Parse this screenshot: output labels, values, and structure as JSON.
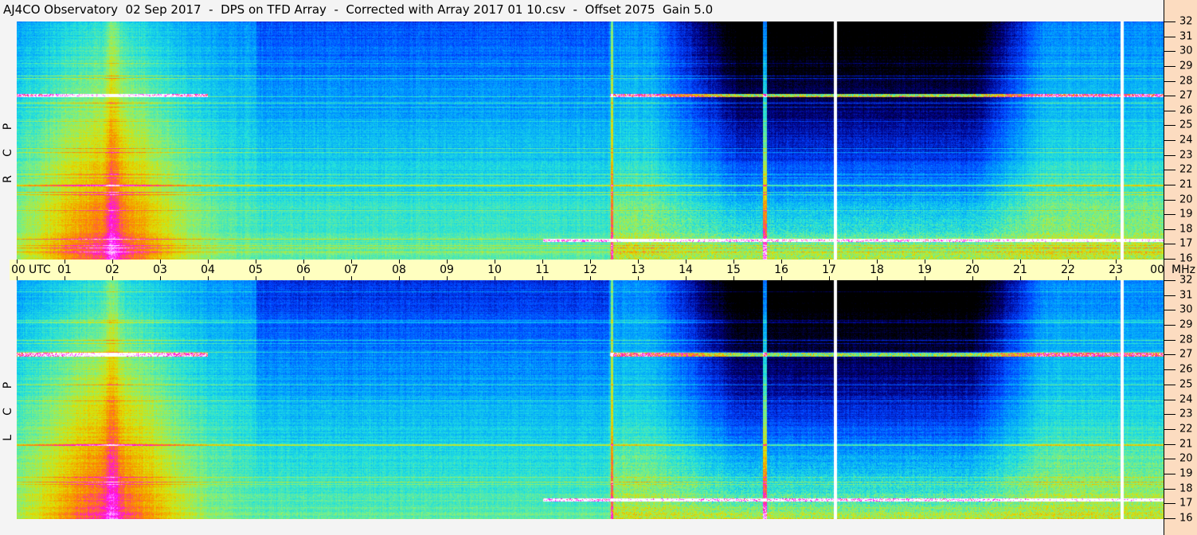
{
  "title": "AJ4CO Observatory  02 Sep 2017  -  DPS on TFD Array  -  Corrected with Array 2017 01 10.csv  -  Offset 2075  Gain 5.0",
  "chart_data": {
    "type": "heatmap",
    "title": "AJ4CO Observatory  02 Sep 2017  -  DPS on TFD Array  -  Corrected with Array 2017 01 10.csv  -  Offset 2075  Gain 5.0",
    "panels": [
      {
        "label": [
          "R",
          "C",
          "P"
        ]
      },
      {
        "label": [
          "L",
          "C",
          "P"
        ]
      }
    ],
    "x_unit": "UTC",
    "x_tick_labels": [
      "00",
      "01",
      "02",
      "03",
      "04",
      "05",
      "06",
      "07",
      "08",
      "09",
      "10",
      "11",
      "12",
      "13",
      "14",
      "15",
      "16",
      "17",
      "18",
      "19",
      "20",
      "21",
      "22",
      "23",
      "00"
    ],
    "xlim_hours": [
      0,
      24
    ],
    "y_unit": "MHz",
    "y_tick_labels": [
      "32",
      "31",
      "30",
      "29",
      "28",
      "27",
      "26",
      "25",
      "24",
      "23",
      "22",
      "21",
      "20",
      "19",
      "18",
      "17",
      "16"
    ],
    "ylim_mhz": [
      16,
      32
    ],
    "colormap": [
      "#000000",
      "#000080",
      "#0040ff",
      "#00a0ff",
      "#20e0e0",
      "#80f080",
      "#e0e000",
      "#ff8000",
      "#ff00ff",
      "#ffffff"
    ],
    "colors": {
      "axis_band": "#ffffc0",
      "right_axis": "#fcdcc0",
      "background": "#f4f4f4"
    }
  }
}
